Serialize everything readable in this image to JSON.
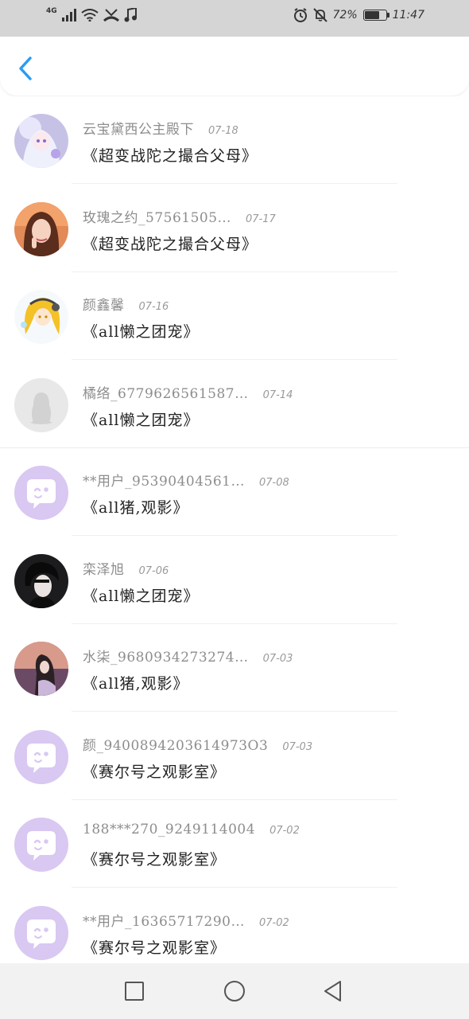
{
  "status_bar": {
    "network": "4G",
    "battery": "72%",
    "battery_level": 0.72,
    "time": "11:47",
    "icons": [
      "signal-icon",
      "wifi-icon",
      "missed-call-icon",
      "music-note-icon",
      "alarm-icon",
      "mute-icon",
      "battery-icon"
    ]
  },
  "header": {
    "back_icon": "chevron-left-icon",
    "accent_color": "#2b9cf2"
  },
  "items": [
    {
      "name": "云宝黛西公主殿下",
      "date": "07-18",
      "message": "《超变战陀之撮合父母》",
      "avatar": "anime-girl"
    },
    {
      "name": "玫瑰之约_57561505…",
      "date": "07-17",
      "message": "《超变战陀之撮合父母》",
      "avatar": "woman-photo"
    },
    {
      "name": "颜鑫馨",
      "date": "07-16",
      "message": "《all懒之团宠》",
      "avatar": "yellow-hair-anime"
    },
    {
      "name": "橘络_6779626561587…",
      "date": "07-14",
      "message": "《all懒之团宠》",
      "avatar": "default-penguin"
    },
    {
      "name": "**用户_95390404561…",
      "date": "07-08",
      "message": "《all猪,观影》",
      "avatar": "default-chat-bubble"
    },
    {
      "name": "栾泽旭",
      "date": "07-06",
      "message": "《all懒之团宠》",
      "avatar": "dark-portrait"
    },
    {
      "name": "水柒_9680934273274…",
      "date": "07-03",
      "message": "《all猪,观影》",
      "avatar": "sunset-girl"
    },
    {
      "name": "颜_9400894203614973O3",
      "date": "07-03",
      "message": "《赛尔号之观影室》",
      "avatar": "default-chat-bubble"
    },
    {
      "name": "188***270_9249114004",
      "date": "07-02",
      "message": "《赛尔号之观影室》",
      "avatar": "default-chat-bubble"
    },
    {
      "name": "**用户_16365717290…",
      "date": "07-02",
      "message": "《赛尔号之观影室》",
      "avatar": "default-chat-bubble"
    }
  ],
  "nav": {
    "icons": [
      "recent-apps-icon",
      "home-icon",
      "back-triangle-icon"
    ]
  },
  "colors": {
    "default_avatar_purple": "#d9c8f2",
    "status_bar_bg": "#d5d5d5",
    "nav_bar_bg": "#f2f2f2"
  }
}
